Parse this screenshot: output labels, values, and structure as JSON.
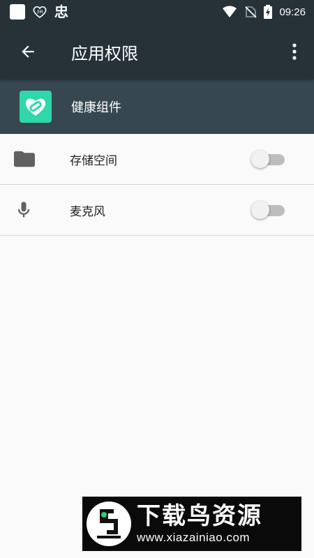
{
  "status_bar": {
    "time": "09:26",
    "icons_left": [
      "notification-square-icon",
      "heart-badge-icon",
      "bug-icon"
    ],
    "icons_right": [
      "wifi-icon",
      "no-sim-icon",
      "battery-charging-icon"
    ],
    "bug_glyph": "忠"
  },
  "app_bar": {
    "title": "应用权限",
    "back_icon": "arrow-back-icon",
    "more_icon": "more-vert-icon"
  },
  "app_header": {
    "app_name": "健康组件",
    "icon_color": "#2fd8a8"
  },
  "permissions": [
    {
      "label": "存储空间",
      "icon": "folder-icon",
      "enabled": false
    },
    {
      "label": "麦克风",
      "icon": "microphone-icon",
      "enabled": false
    }
  ],
  "watermark": {
    "title": "下载鸟资源",
    "url": "www.xiazainiao.com"
  },
  "colors": {
    "toolbar": "#263238",
    "app_header": "#37474f",
    "background": "#fafafa"
  }
}
